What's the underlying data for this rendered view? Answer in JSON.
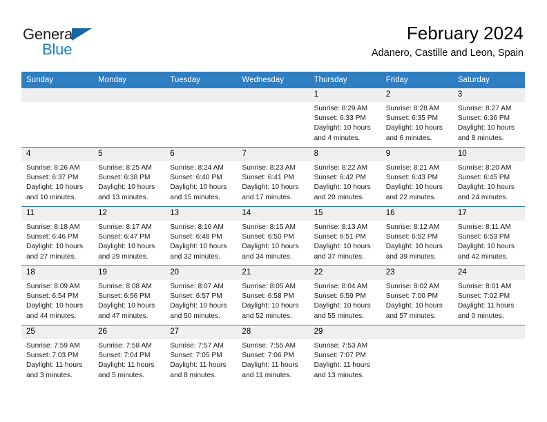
{
  "brand": {
    "name_part1": "General",
    "name_part2": "Blue",
    "accent_color": "#1a7fc1",
    "triangle_color": "#1565a8"
  },
  "header": {
    "title": "February 2024",
    "location": "Adanero, Castille and Leon, Spain"
  },
  "theme": {
    "header_row_color": "#2f7ec1",
    "daynum_band_color": "#efefef",
    "cell_background": "#ffffff",
    "text_color": "#000000"
  },
  "calendar": {
    "weekday_headers": [
      "Sunday",
      "Monday",
      "Tuesday",
      "Wednesday",
      "Thursday",
      "Friday",
      "Saturday"
    ],
    "weeks": [
      [
        {
          "day": "",
          "sunrise": "",
          "sunset": "",
          "daylight": "",
          "empty": true
        },
        {
          "day": "",
          "sunrise": "",
          "sunset": "",
          "daylight": "",
          "empty": true
        },
        {
          "day": "",
          "sunrise": "",
          "sunset": "",
          "daylight": "",
          "empty": true
        },
        {
          "day": "",
          "sunrise": "",
          "sunset": "",
          "daylight": "",
          "empty": true
        },
        {
          "day": "1",
          "sunrise": "Sunrise: 8:29 AM",
          "sunset": "Sunset: 6:33 PM",
          "daylight": "Daylight: 10 hours and 4 minutes.",
          "empty": false
        },
        {
          "day": "2",
          "sunrise": "Sunrise: 8:28 AM",
          "sunset": "Sunset: 6:35 PM",
          "daylight": "Daylight: 10 hours and 6 minutes.",
          "empty": false
        },
        {
          "day": "3",
          "sunrise": "Sunrise: 8:27 AM",
          "sunset": "Sunset: 6:36 PM",
          "daylight": "Daylight: 10 hours and 8 minutes.",
          "empty": false
        }
      ],
      [
        {
          "day": "4",
          "sunrise": "Sunrise: 8:26 AM",
          "sunset": "Sunset: 6:37 PM",
          "daylight": "Daylight: 10 hours and 10 minutes.",
          "empty": false
        },
        {
          "day": "5",
          "sunrise": "Sunrise: 8:25 AM",
          "sunset": "Sunset: 6:38 PM",
          "daylight": "Daylight: 10 hours and 13 minutes.",
          "empty": false
        },
        {
          "day": "6",
          "sunrise": "Sunrise: 8:24 AM",
          "sunset": "Sunset: 6:40 PM",
          "daylight": "Daylight: 10 hours and 15 minutes.",
          "empty": false
        },
        {
          "day": "7",
          "sunrise": "Sunrise: 8:23 AM",
          "sunset": "Sunset: 6:41 PM",
          "daylight": "Daylight: 10 hours and 17 minutes.",
          "empty": false
        },
        {
          "day": "8",
          "sunrise": "Sunrise: 8:22 AM",
          "sunset": "Sunset: 6:42 PM",
          "daylight": "Daylight: 10 hours and 20 minutes.",
          "empty": false
        },
        {
          "day": "9",
          "sunrise": "Sunrise: 8:21 AM",
          "sunset": "Sunset: 6:43 PM",
          "daylight": "Daylight: 10 hours and 22 minutes.",
          "empty": false
        },
        {
          "day": "10",
          "sunrise": "Sunrise: 8:20 AM",
          "sunset": "Sunset: 6:45 PM",
          "daylight": "Daylight: 10 hours and 24 minutes.",
          "empty": false
        }
      ],
      [
        {
          "day": "11",
          "sunrise": "Sunrise: 8:18 AM",
          "sunset": "Sunset: 6:46 PM",
          "daylight": "Daylight: 10 hours and 27 minutes.",
          "empty": false
        },
        {
          "day": "12",
          "sunrise": "Sunrise: 8:17 AM",
          "sunset": "Sunset: 6:47 PM",
          "daylight": "Daylight: 10 hours and 29 minutes.",
          "empty": false
        },
        {
          "day": "13",
          "sunrise": "Sunrise: 8:16 AM",
          "sunset": "Sunset: 6:48 PM",
          "daylight": "Daylight: 10 hours and 32 minutes.",
          "empty": false
        },
        {
          "day": "14",
          "sunrise": "Sunrise: 8:15 AM",
          "sunset": "Sunset: 6:50 PM",
          "daylight": "Daylight: 10 hours and 34 minutes.",
          "empty": false
        },
        {
          "day": "15",
          "sunrise": "Sunrise: 8:13 AM",
          "sunset": "Sunset: 6:51 PM",
          "daylight": "Daylight: 10 hours and 37 minutes.",
          "empty": false
        },
        {
          "day": "16",
          "sunrise": "Sunrise: 8:12 AM",
          "sunset": "Sunset: 6:52 PM",
          "daylight": "Daylight: 10 hours and 39 minutes.",
          "empty": false
        },
        {
          "day": "17",
          "sunrise": "Sunrise: 8:11 AM",
          "sunset": "Sunset: 6:53 PM",
          "daylight": "Daylight: 10 hours and 42 minutes.",
          "empty": false
        }
      ],
      [
        {
          "day": "18",
          "sunrise": "Sunrise: 8:09 AM",
          "sunset": "Sunset: 6:54 PM",
          "daylight": "Daylight: 10 hours and 44 minutes.",
          "empty": false
        },
        {
          "day": "19",
          "sunrise": "Sunrise: 8:08 AM",
          "sunset": "Sunset: 6:56 PM",
          "daylight": "Daylight: 10 hours and 47 minutes.",
          "empty": false
        },
        {
          "day": "20",
          "sunrise": "Sunrise: 8:07 AM",
          "sunset": "Sunset: 6:57 PM",
          "daylight": "Daylight: 10 hours and 50 minutes.",
          "empty": false
        },
        {
          "day": "21",
          "sunrise": "Sunrise: 8:05 AM",
          "sunset": "Sunset: 6:58 PM",
          "daylight": "Daylight: 10 hours and 52 minutes.",
          "empty": false
        },
        {
          "day": "22",
          "sunrise": "Sunrise: 8:04 AM",
          "sunset": "Sunset: 6:59 PM",
          "daylight": "Daylight: 10 hours and 55 minutes.",
          "empty": false
        },
        {
          "day": "23",
          "sunrise": "Sunrise: 8:02 AM",
          "sunset": "Sunset: 7:00 PM",
          "daylight": "Daylight: 10 hours and 57 minutes.",
          "empty": false
        },
        {
          "day": "24",
          "sunrise": "Sunrise: 8:01 AM",
          "sunset": "Sunset: 7:02 PM",
          "daylight": "Daylight: 11 hours and 0 minutes.",
          "empty": false
        }
      ],
      [
        {
          "day": "25",
          "sunrise": "Sunrise: 7:59 AM",
          "sunset": "Sunset: 7:03 PM",
          "daylight": "Daylight: 11 hours and 3 minutes.",
          "empty": false
        },
        {
          "day": "26",
          "sunrise": "Sunrise: 7:58 AM",
          "sunset": "Sunset: 7:04 PM",
          "daylight": "Daylight: 11 hours and 5 minutes.",
          "empty": false
        },
        {
          "day": "27",
          "sunrise": "Sunrise: 7:57 AM",
          "sunset": "Sunset: 7:05 PM",
          "daylight": "Daylight: 11 hours and 8 minutes.",
          "empty": false
        },
        {
          "day": "28",
          "sunrise": "Sunrise: 7:55 AM",
          "sunset": "Sunset: 7:06 PM",
          "daylight": "Daylight: 11 hours and 11 minutes.",
          "empty": false
        },
        {
          "day": "29",
          "sunrise": "Sunrise: 7:53 AM",
          "sunset": "Sunset: 7:07 PM",
          "daylight": "Daylight: 11 hours and 13 minutes.",
          "empty": false
        },
        {
          "day": "",
          "sunrise": "",
          "sunset": "",
          "daylight": "",
          "empty": true
        },
        {
          "day": "",
          "sunrise": "",
          "sunset": "",
          "daylight": "",
          "empty": true
        }
      ]
    ]
  }
}
